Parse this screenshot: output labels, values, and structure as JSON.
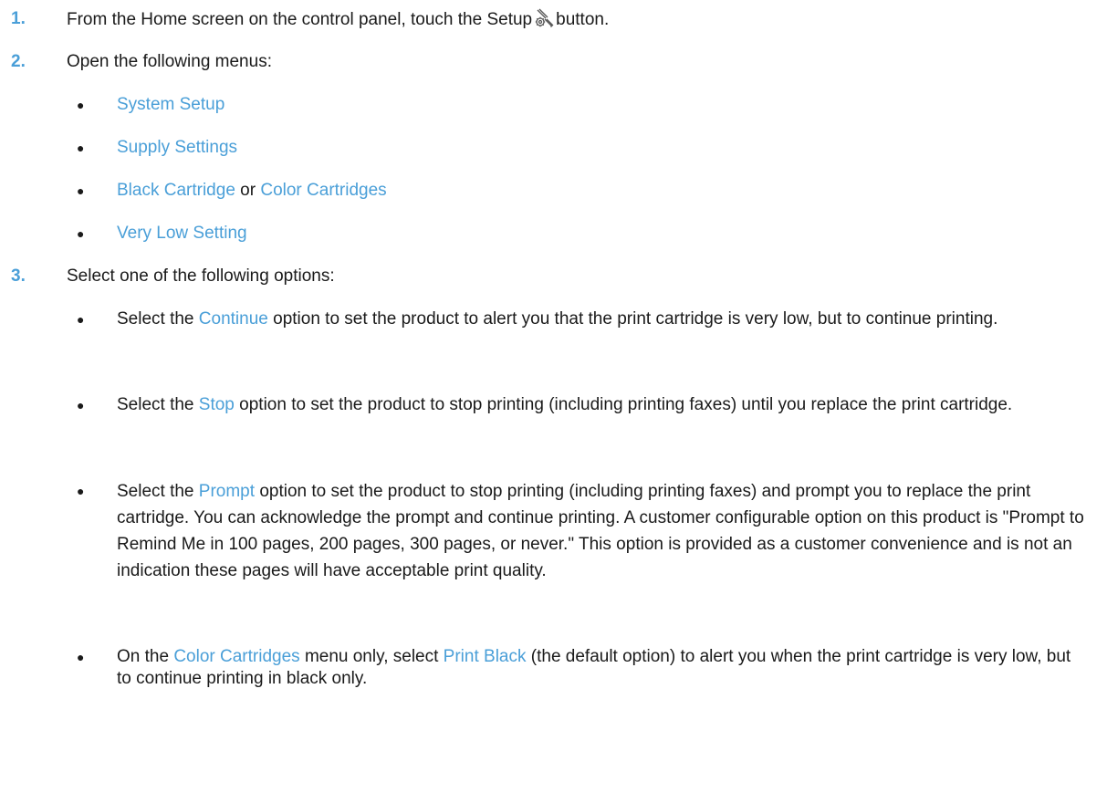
{
  "steps": [
    {
      "number": "1.",
      "text_before": "From the Home screen on the control panel, touch the Setup",
      "text_after": "button.",
      "icon": "setup-icon"
    },
    {
      "number": "2.",
      "text": "Open the following menus:",
      "bullets": [
        {
          "menu": "System Setup"
        },
        {
          "menu": "Supply Settings"
        },
        {
          "menu_a": "Black Cartridge",
          "connector": "or",
          "menu_b": "Color Cartridges"
        },
        {
          "menu": "Very Low Setting"
        }
      ]
    },
    {
      "number": "3.",
      "text": "Select one of the following options:",
      "bullets": [
        {
          "lead": "Select the",
          "menu": "Continue",
          "rest": "option to set the product to alert you that the print cartridge is very low, but to continue printing."
        },
        {
          "lead": "Select the",
          "menu": "Stop",
          "rest": "option to set the product to stop printing (including printing faxes) until you replace the print cartridge."
        },
        {
          "lead": "Select the",
          "menu": "Prompt",
          "rest": "option to set the product to stop printing (including printing faxes) and prompt you to replace the print cartridge. You can acknowledge the prompt and continue printing. A customer configurable option on this product is \"Prompt to Remind Me in 100 pages, 200 pages, 300 pages, or never.\" This option is provided as a customer convenience and is not an indication these pages will have acceptable print quality."
        },
        {
          "lead": "On the",
          "menu": "Color Cartridges",
          "middle": "menu only, select",
          "menu_2": "Print Black",
          "rest": "(the default option) to alert you when the print cartridge is very low, but to continue printing in black only."
        }
      ]
    }
  ],
  "colors": {
    "accent": "#4a9fd8",
    "text": "#1a1a1a"
  }
}
